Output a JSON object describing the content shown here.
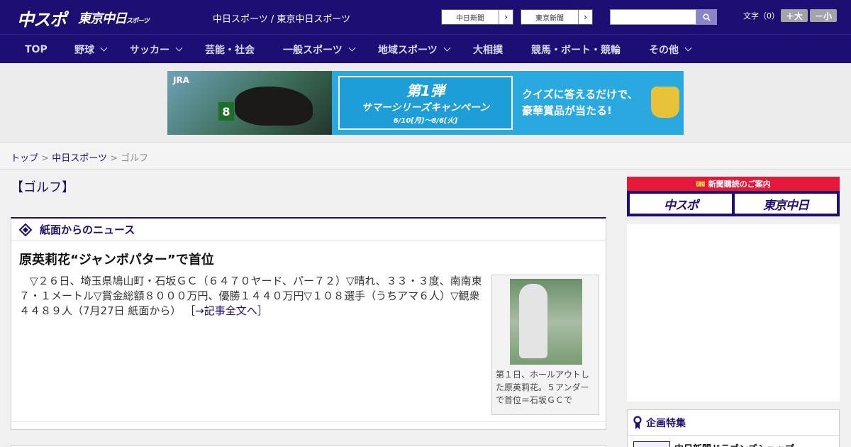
{
  "header": {
    "logo_chuspo": "中スポ",
    "logo_tokyo": "東京中日",
    "logo_tokyo_sub": "スポーツ",
    "site_title": "中日スポーツ / 東京中日スポーツ",
    "paper_links": [
      "中日新聞",
      "東京新聞"
    ],
    "search_placeholder": "",
    "font_size_label": "文字（0）",
    "font_larger": "＋大",
    "font_smaller": "－小"
  },
  "nav": {
    "items": [
      {
        "label": "TOP",
        "has_menu": false
      },
      {
        "label": "野球",
        "has_menu": true
      },
      {
        "label": "サッカー",
        "has_menu": true
      },
      {
        "label": "芸能・社会",
        "has_menu": false
      },
      {
        "label": "一般スポーツ",
        "has_menu": true
      },
      {
        "label": "地域スポーツ",
        "has_menu": true
      },
      {
        "label": "大相撲",
        "has_menu": false
      },
      {
        "label": "競馬・ボート・競輪",
        "has_menu": false
      },
      {
        "label": "その他",
        "has_menu": true
      }
    ]
  },
  "banner": {
    "brand": "JRA",
    "saddle_number": "8",
    "campaign_title": "第1弾",
    "campaign_name": "サマーシリーズキャンペーン",
    "campaign_dates": "6/10[月]～8/6[火]",
    "quiz_line1": "クイズに答えるだけで、",
    "quiz_line2": "豪華賞品が当たる!"
  },
  "breadcrumb": {
    "home": "トップ",
    "section": "中日スポーツ",
    "current": "ゴルフ",
    "separator": ">"
  },
  "page": {
    "title": "【ゴルフ】"
  },
  "news": {
    "heading": "紙面からのニュース",
    "title": "原英莉花“ジャンボパター”で首位",
    "body": "　▽２６日、埼玉県鳩山町・石坂ＧＣ（６４７０ヤード、パー７２）▽晴れ、３３・３度、南南東７・１メートル▽賞金総額８０００万円、優勝１４４０万円▽１０８選手（うちアマ６人）▽観衆４４８９人（7月27日 紙面から）",
    "more_link": "［→記事全文へ］",
    "photo_caption": "第１日、ホールアウトした原英莉花。５アンダーで首位＝石坂ＧＣで"
  },
  "sidebar": {
    "subscribe_heading": "新聞購読のご案内",
    "subscribe_logos": [
      "中スポ",
      "東京中日"
    ],
    "feature_heading": "企画特集",
    "feature_item": "中日新聞ドラゴンズショップ"
  },
  "colors": {
    "brand_navy": "#1d0e73",
    "accent_red": "#e8183a"
  }
}
